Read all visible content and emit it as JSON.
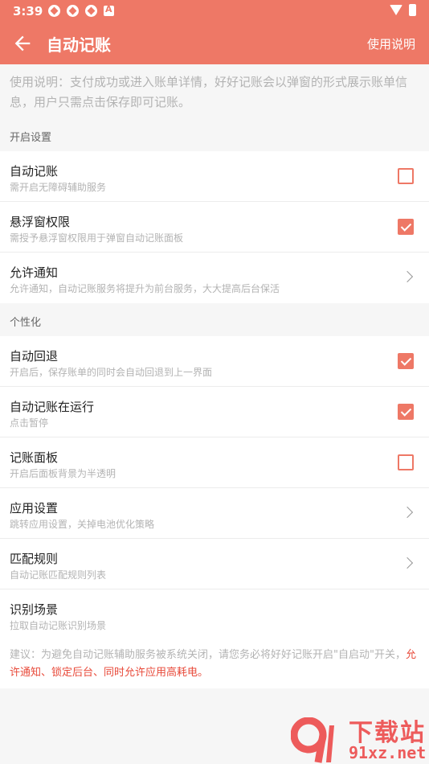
{
  "status_bar": {
    "time": "3:39"
  },
  "app_bar": {
    "title": "自动记账",
    "help_label": "使用说明"
  },
  "intro": "使用说明：支付成功或进入账单详情，好好记账会以弹窗的形式展示账单信息，用户只需点击保存即可记账。",
  "sections": {
    "enable": {
      "header": "开启设置",
      "items": [
        {
          "title": "自动记账",
          "subtitle": "需开启无障碍辅助服务",
          "control": "checkbox",
          "checked": false
        },
        {
          "title": "悬浮窗权限",
          "subtitle": "需授予悬浮窗权限用于弹窗自动记账面板",
          "control": "checkbox",
          "checked": true
        },
        {
          "title": "允许通知",
          "subtitle": "允许通知，自动记账服务将提升为前台服务，大大提高后台保活",
          "control": "chevron"
        }
      ]
    },
    "personal": {
      "header": "个性化",
      "items": [
        {
          "title": "自动回退",
          "subtitle": "开启后，保存账单的同时会自动回退到上一界面",
          "control": "checkbox",
          "checked": true
        },
        {
          "title": "自动记账在运行",
          "subtitle": "点击暂停",
          "control": "checkbox",
          "checked": true
        },
        {
          "title": "记账面板",
          "subtitle": "开启后面板背景为半透明",
          "control": "checkbox",
          "checked": false
        },
        {
          "title": "应用设置",
          "subtitle": "跳转应用设置，关掉电池优化策略",
          "control": "chevron"
        },
        {
          "title": "匹配规则",
          "subtitle": "自动记账匹配规则列表",
          "control": "chevron"
        },
        {
          "title": "识别场景",
          "subtitle": "拉取自动记账识别场景",
          "control": "none"
        }
      ]
    }
  },
  "advice": {
    "grey": "建议：为避免自动记账辅助服务被系统关闭，请您务必将好好记账开启\"自启动\"开关，",
    "red": "允许通知、锁定后台、同时允许应用高耗电。"
  },
  "watermark": {
    "text": "下载站",
    "url": "91xz.net"
  },
  "colors": {
    "accent": "#ee7866",
    "warning": "#e84a3a"
  }
}
